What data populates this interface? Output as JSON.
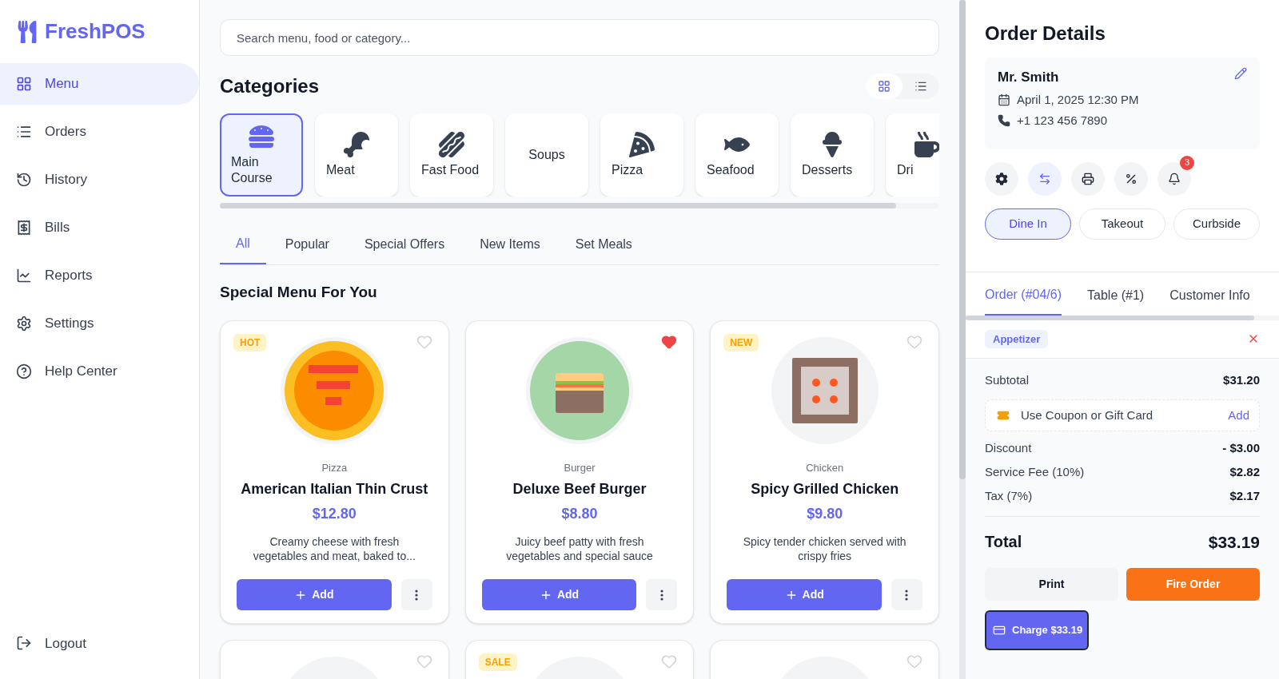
{
  "brand": {
    "name": "FreshPOS"
  },
  "sidebar": {
    "items": [
      {
        "label": "Menu",
        "selected": true
      },
      {
        "label": "Orders",
        "selected": false
      },
      {
        "label": "History",
        "selected": false
      },
      {
        "label": "Bills",
        "selected": false
      },
      {
        "label": "Reports",
        "selected": false
      },
      {
        "label": "Settings",
        "selected": false
      },
      {
        "label": "Help Center",
        "selected": false
      }
    ],
    "logout": "Logout"
  },
  "search": {
    "placeholder": "Search menu, food or category..."
  },
  "categories": {
    "title": "Categories",
    "view_modes": [
      {
        "selected": true
      },
      {
        "selected": false
      }
    ],
    "items": [
      {
        "label": "Main Course",
        "selected": true
      },
      {
        "label": "Meat",
        "selected": false
      },
      {
        "label": "Fast Food",
        "selected": false
      },
      {
        "label": "Soups",
        "selected": false
      },
      {
        "label": "Pizza",
        "selected": false
      },
      {
        "label": "Seafood",
        "selected": false
      },
      {
        "label": "Desserts",
        "selected": false
      },
      {
        "label": "Dri",
        "selected": false
      }
    ]
  },
  "filter_tabs": [
    {
      "label": "All",
      "selected": true
    },
    {
      "label": "Popular",
      "selected": false
    },
    {
      "label": "Special Offers",
      "selected": false
    },
    {
      "label": "New Items",
      "selected": false
    },
    {
      "label": "Set Meals",
      "selected": false
    }
  ],
  "menu": {
    "title": "Special Menu For You",
    "items": [
      {
        "kind": "pizza",
        "badge": "HOT",
        "favorite": false,
        "category": "Pizza",
        "name": "American Italian Thin Crust",
        "price": "$12.80",
        "add_label": "Add",
        "description": "Creamy cheese with fresh vegetables and meat, baked to..."
      },
      {
        "kind": "burger",
        "favorite": true,
        "category": "Burger",
        "name": "Deluxe Beef Burger",
        "price": "$8.80",
        "add_label": "Add",
        "description": "Juicy beef patty with fresh vegetables and special sauce"
      },
      {
        "kind": "chicken",
        "badge": "NEW",
        "favorite": false,
        "category": "Chicken",
        "name": "Spicy Grilled Chicken",
        "price": "$9.80",
        "add_label": "Add",
        "description": "Spicy tender chicken served with crispy fries"
      },
      {
        "kind": "partial",
        "favorite": false
      },
      {
        "kind": "partial",
        "badge": "SALE",
        "favorite": false
      },
      {
        "kind": "partial",
        "favorite": false
      }
    ]
  },
  "order": {
    "title": "Order Details",
    "customer": {
      "name": "Mr. Smith",
      "date": "April 1, 2025 12:30 PM",
      "phone": "+1 123 456 7890"
    },
    "actions": [
      {
        "selected": false
      },
      {
        "selected": true
      },
      {
        "selected": false
      },
      {
        "selected": false
      },
      {
        "selected": false,
        "badge": "3"
      }
    ],
    "types": [
      {
        "label": "Dine In",
        "selected": true
      },
      {
        "label": "Takeout",
        "selected": false
      },
      {
        "label": "Curbside",
        "selected": false
      }
    ],
    "tabs": [
      {
        "label": "Order (#04/6)",
        "selected": true
      },
      {
        "label": "Table (#1)",
        "selected": false
      },
      {
        "label": "Customer Info",
        "selected": false
      }
    ],
    "group_tag": "Appetizer",
    "subtotal": {
      "label": "Subtotal",
      "value": "$31.20"
    },
    "coupon": {
      "label": "Use Coupon or Gift Card",
      "action": "Add"
    },
    "lines": [
      {
        "label": "Discount",
        "value": "- $3.00"
      },
      {
        "label": "Service Fee (10%)",
        "value": "$2.82"
      },
      {
        "label": "Tax (7%)",
        "value": "$2.17"
      }
    ],
    "total": {
      "label": "Total",
      "value": "$33.19"
    },
    "print": "Print",
    "fire": "Fire Order",
    "charge": "Charge $33.19"
  }
}
